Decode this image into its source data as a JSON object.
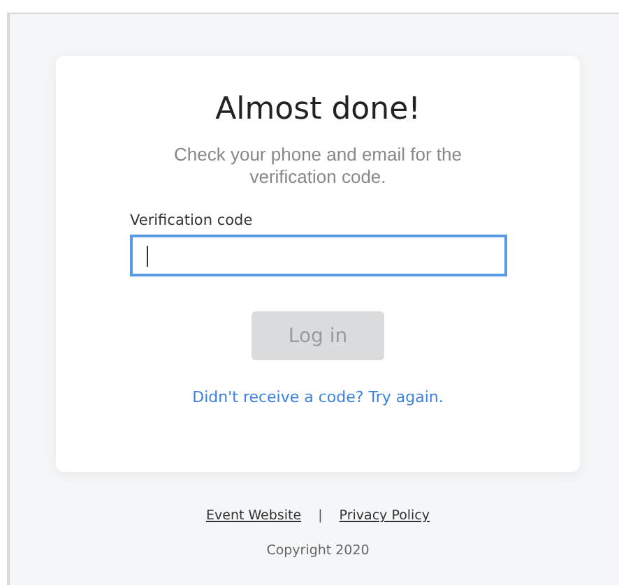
{
  "card": {
    "title": "Almost done!",
    "subtitle": "Check your phone and email for the verification code.",
    "field": {
      "label": "Verification code",
      "focused": true
    },
    "button": {
      "label": "Log in",
      "disabled": true
    },
    "resend_link": "Didn't receive a code? Try again."
  },
  "footer": {
    "links": [
      "Event Website",
      "Privacy Policy"
    ],
    "separator": "|",
    "copyright": "Copyright 2020"
  }
}
